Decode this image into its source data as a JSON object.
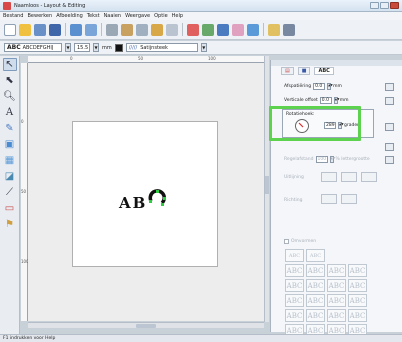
{
  "window": {
    "title": "Naamloos - Layout & Editing",
    "buttons": [
      "minimize-icon",
      "maximize-icon",
      "close-icon"
    ]
  },
  "menu": [
    "Bestand",
    "Bewerken",
    "Afbeelding",
    "Tekst",
    "Naaien",
    "Weergave",
    "Optie",
    "Help"
  ],
  "toolbar": {
    "icons": [
      "new-file-icon",
      "open-icon",
      "save-icon",
      "print-icon",
      "cut-icon",
      "copy-icon",
      "paste-icon",
      "undo-icon",
      "redo-icon",
      "hoop-icon",
      "zoom-icon",
      "wizard-icon",
      "color-icon",
      "design-icon",
      "stitch-icon",
      "settings-icon",
      "help-icon"
    ],
    "font_sample": "ABC",
    "font_name": "ABCDEFGHIJ",
    "size_value": "15.5",
    "size_unit": "mm",
    "stitch_label": "Satijnsteek"
  },
  "tools": [
    "select",
    "point-edit",
    "zoom",
    "text",
    "outline",
    "shape",
    "fill",
    "brush",
    "eyedropper",
    "ruler",
    "punch"
  ],
  "ruler": {
    "top": [
      "0",
      "50",
      "100"
    ],
    "left": [
      "0",
      "50",
      "100"
    ]
  },
  "canvas": {
    "text_left": "A",
    "text_mid": "B"
  },
  "panel": {
    "tabs": [
      "ABC"
    ],
    "offset_h_label": "Afspatiëring",
    "offset_h_value": "0.0",
    "offset_h_unit": "mm",
    "offset_v_label": "Verticale offset",
    "offset_v_value": "0.0",
    "offset_v_unit": "mm",
    "rotate_label": "Rotatiehoek:",
    "rotate_value": "289",
    "rotate_unit": "graden",
    "spacing_label": "Regelafstand",
    "spacing_value": "100",
    "spacing_unit": "% lettergrootte",
    "align_label": "Uitlijning",
    "dir_label": "Richting",
    "check_label": "Omvormen",
    "text_styles": [
      "ABC",
      "ABC",
      "ABC",
      "ABC",
      "ABC",
      "ABC",
      "ABC",
      "ABC",
      "ABC",
      "ABC",
      "ABC",
      "ABC",
      "ABC",
      "ABC",
      "ABC",
      "ABC",
      "ABC",
      "ABC",
      "ABC",
      "ABC",
      "ABC",
      "ABC",
      "ABC",
      "ABC"
    ]
  },
  "status": "F1 indrukken voor Help",
  "colors": {
    "highlight": "#5cd24e",
    "accent": "#d84848"
  }
}
